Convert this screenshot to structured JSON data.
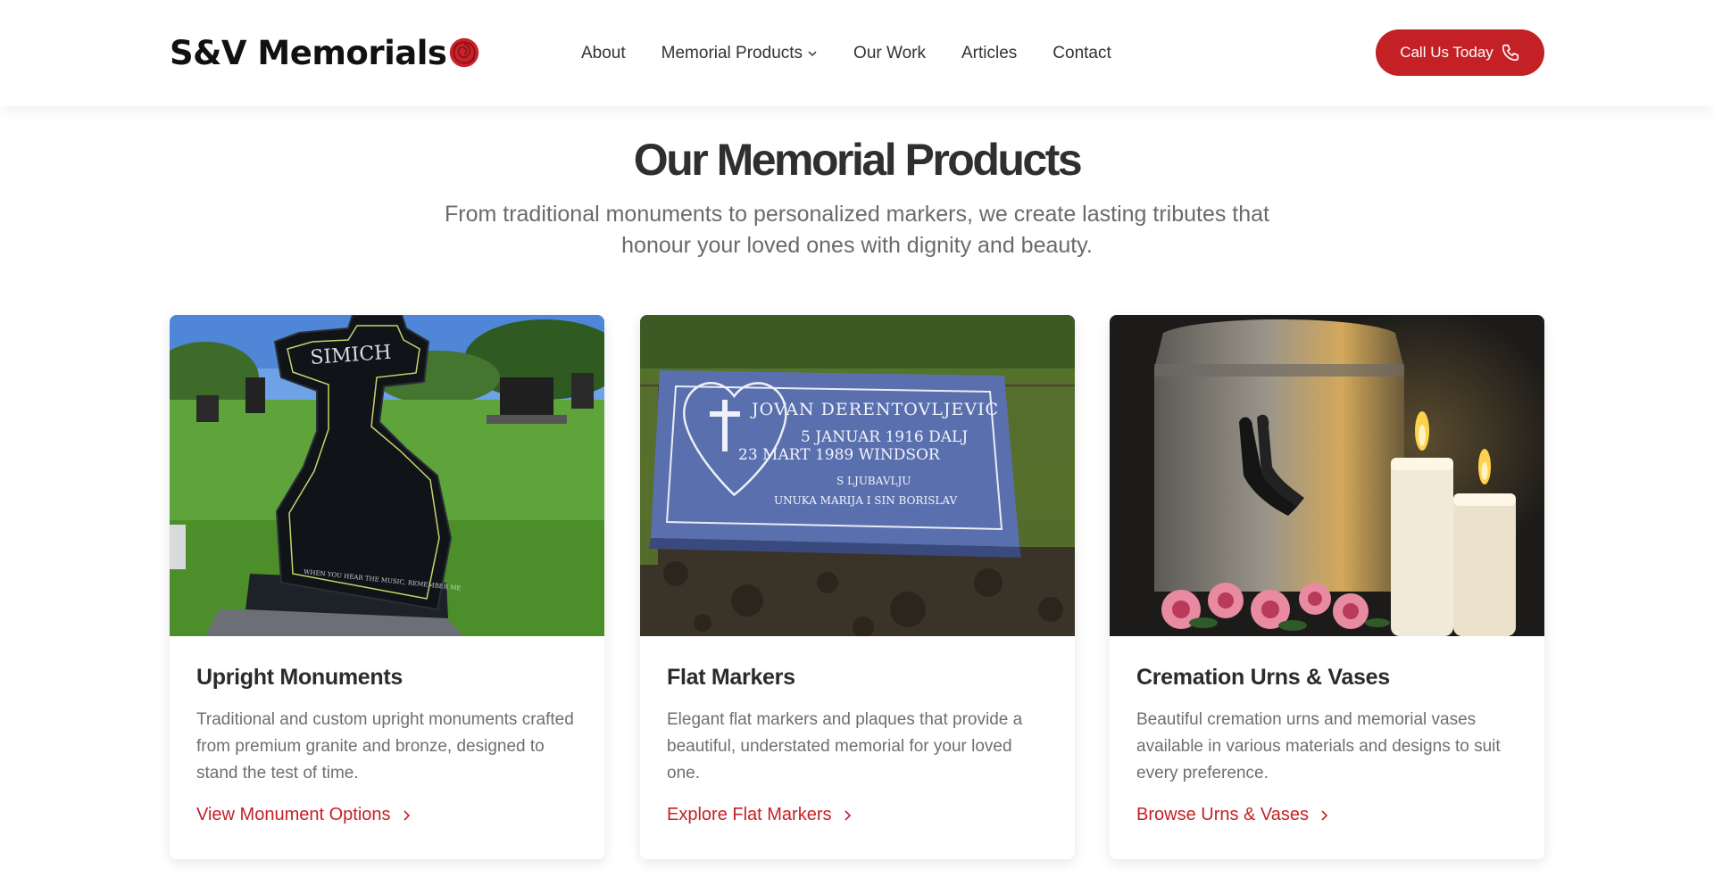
{
  "header": {
    "logo_text": "S&V Memorials",
    "logo_icon": "rose-icon",
    "nav": [
      {
        "label": "About"
      },
      {
        "label": "Memorial Products",
        "has_dropdown": true
      },
      {
        "label": "Our Work"
      },
      {
        "label": "Articles"
      },
      {
        "label": "Contact"
      }
    ],
    "cta_label": "Call Us Today",
    "cta_icon": "phone-icon"
  },
  "section": {
    "title": "Our Memorial Products",
    "subtitle": "From traditional monuments to personalized markers, we create lasting tributes that honour your loved ones with dignity and beauty."
  },
  "products": [
    {
      "title": "Upright Monuments",
      "description": "Traditional and custom upright monuments crafted from premium granite and bronze, designed to stand the test of time.",
      "link": "View Monument Options",
      "image": {
        "name_on_stone": "SIMICH",
        "inscription": "WHEN YOU HEAR THE MUSIC, REMEMBER ME"
      }
    },
    {
      "title": "Flat Markers",
      "description": "Elegant flat markers and plaques that provide a beautiful, understated memorial for your loved one.",
      "link": "Explore Flat Markers",
      "image": {
        "line1": "JOVAN DERENTOVLJEVIC",
        "line2": "5  JANUAR 1916  DALJ",
        "line3": "23  MART 1989  WINDSOR",
        "line4": "S LJUBAVLJU",
        "line5": "UNUKA MARIJA I SIN BORISLAV"
      }
    },
    {
      "title": "Cremation Urns & Vases",
      "description": "Beautiful cremation urns and memorial vases available in various materials and designs to suit every preference.",
      "link": "Browse Urns & Vases",
      "image": {}
    }
  ],
  "colors": {
    "accent": "#c42127",
    "heading": "#2f2f2f",
    "body_text": "#6f6f6f"
  }
}
